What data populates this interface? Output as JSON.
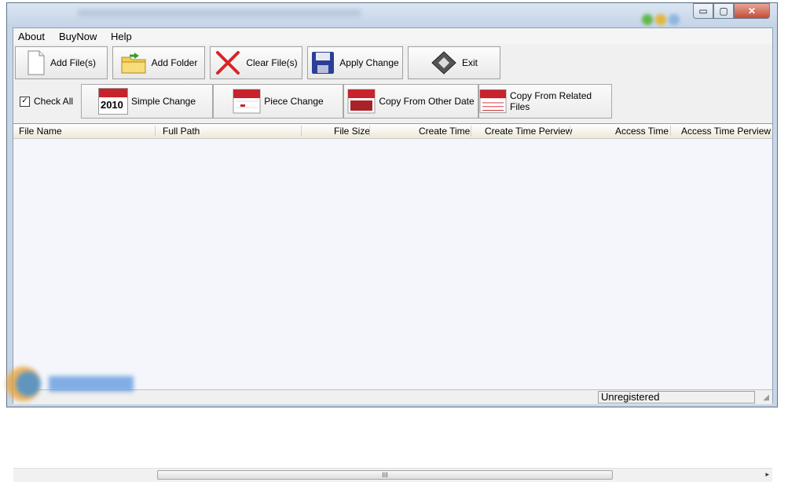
{
  "colors": {
    "accent_red": "#d92525",
    "calendar_red": "#c8232c",
    "window_frame": "#c8d6e6",
    "list_bg": "#f4f6fc"
  },
  "menu": [
    "About",
    "BuyNow",
    "Help"
  ],
  "toolbar": {
    "add_files": {
      "label": "Add File(s)",
      "icon": "file-icon"
    },
    "add_folder": {
      "label": "Add Folder",
      "icon": "folder-icon"
    },
    "clear_files": {
      "label": "Clear File(s)",
      "icon": "red-x-icon"
    },
    "apply_change": {
      "label": "Apply Change",
      "icon": "floppy-disk-icon"
    },
    "exit": {
      "label": "Exit",
      "icon": "exit-icon"
    }
  },
  "toolbar2": {
    "check_all": {
      "label": "Check All",
      "checked": true
    },
    "simple_change": {
      "label": "Simple Change",
      "icon_text": "2010"
    },
    "piece_change": {
      "label": "Piece Change"
    },
    "copy_from_other_date": {
      "label": "Copy From Other Date"
    },
    "copy_from_related_files": {
      "label": "Copy From Related Files"
    }
  },
  "columns": [
    "File Name",
    "Full Path",
    "File Size",
    "Create Time",
    "Create Time Perview",
    "Access Time",
    "Access Time Perview"
  ],
  "scrollbar": {
    "thumb_grip": "III",
    "arrow": "▸"
  },
  "status": {
    "right": "Unregistered"
  },
  "window": {
    "minimize": "▭",
    "maximize": "▢",
    "close": "✕"
  }
}
